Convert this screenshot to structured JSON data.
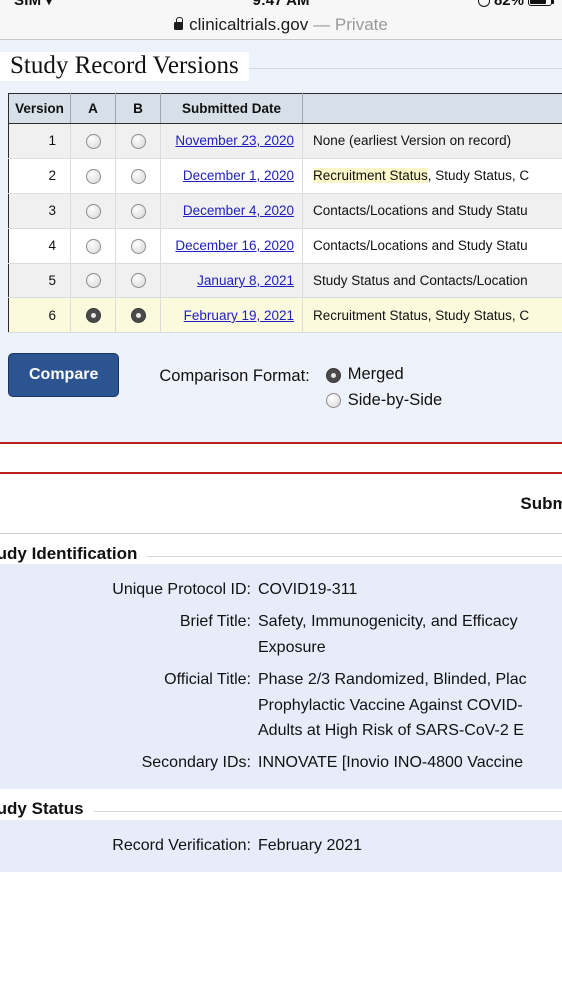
{
  "status_bar": {
    "carrier": "SIM",
    "carrier_caret": "▾",
    "time": "9:47 AM",
    "battery_pct": "82%"
  },
  "browser": {
    "lock_icon": "lock-icon",
    "host": "clinicaltrials.gov",
    "private_label": "— Private"
  },
  "versions_section": {
    "legend": "Study Record Versions",
    "columns": [
      "Version",
      "A",
      "B",
      "Submitted Date",
      ""
    ],
    "rows": [
      {
        "version": "1",
        "a_selected": false,
        "b_selected": false,
        "date": "November 23, 2020",
        "changes_highlight": "",
        "changes": "None (earliest Version on record)",
        "row_style": "alt"
      },
      {
        "version": "2",
        "a_selected": false,
        "b_selected": false,
        "date": "December 1, 2020",
        "changes_highlight": "Recruitment Status",
        "changes": ", Study Status, C",
        "row_style": "plain"
      },
      {
        "version": "3",
        "a_selected": false,
        "b_selected": false,
        "date": "December 4, 2020",
        "changes_highlight": "",
        "changes": "Contacts/Locations and Study Statu",
        "row_style": "alt"
      },
      {
        "version": "4",
        "a_selected": false,
        "b_selected": false,
        "date": "December 16, 2020",
        "changes_highlight": "",
        "changes": "Contacts/Locations and Study Statu",
        "row_style": "plain"
      },
      {
        "version": "5",
        "a_selected": false,
        "b_selected": false,
        "date": "January 8, 2021",
        "changes_highlight": "",
        "changes": "Study Status and Contacts/Location",
        "row_style": "alt"
      },
      {
        "version": "6",
        "a_selected": true,
        "b_selected": true,
        "date": "February 19, 2021",
        "changes_highlight": "",
        "changes": "Recruitment Status, Study Status, C",
        "row_style": "sel"
      }
    ]
  },
  "compare_bar": {
    "button_label": "Compare",
    "format_label": "Comparison Format:",
    "options": [
      {
        "label": "Merged",
        "selected": true
      },
      {
        "label": "Side-by-Side",
        "selected": false
      }
    ]
  },
  "submit_row": {
    "text": "Submit"
  },
  "study_identification": {
    "legend": "tudy Identification",
    "fields": [
      {
        "label": "Unique Protocol ID:",
        "lines": [
          "COVID19-311"
        ]
      },
      {
        "label": "Brief Title:",
        "lines": [
          "Safety, Immunogenicity, and Efficacy",
          "Exposure"
        ]
      },
      {
        "label": "Official Title:",
        "lines": [
          "Phase 2/3 Randomized, Blinded, Plac",
          "Prophylactic Vaccine Against COVID-",
          "Adults at High Risk of SARS-CoV-2 E"
        ]
      },
      {
        "label": "Secondary IDs:",
        "lines": [
          "INNOVATE [Inovio INO-4800 Vaccine"
        ]
      }
    ]
  },
  "study_status": {
    "legend": "tudy Status",
    "fields": [
      {
        "label": "Record Verification:",
        "lines": [
          "February 2021"
        ]
      }
    ]
  },
  "colors": {
    "accent_button": "#2c5490",
    "link": "#2020c0",
    "highlight": "#fcf7c8",
    "red_rule": "#b72121",
    "panel_blue": "#e6ecfa"
  }
}
